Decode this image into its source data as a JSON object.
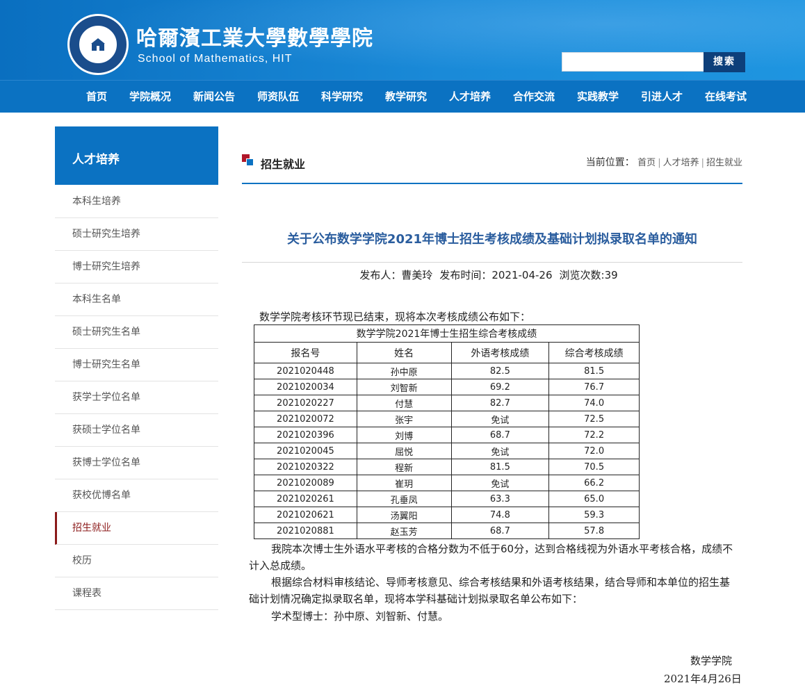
{
  "header": {
    "brand_cn": "哈爾濱工業大學數學學院",
    "brand_en": "School of Mathematics, HIT",
    "search": {
      "placeholder": "",
      "button": "搜索"
    }
  },
  "nav": [
    "首页",
    "学院概况",
    "新闻公告",
    "师资队伍",
    "科学研究",
    "教学研究",
    "人才培养",
    "合作交流",
    "实践教学",
    "引进人才",
    "在线考试"
  ],
  "sidebar": {
    "title": "人才培养",
    "items": [
      "本科生培养",
      "硕士研究生培养",
      "博士研究生培养",
      "本科生名单",
      "硕士研究生名单",
      "博士研究生名单",
      "获学士学位名单",
      "获硕士学位名单",
      "获博士学位名单",
      "获校优博名单",
      "招生就业",
      "校历",
      "课程表"
    ],
    "active": "招生就业"
  },
  "section": {
    "title": "招生就业",
    "breadcrumb_label": "当前位置：",
    "breadcrumb": [
      "首页",
      "人才培养",
      "招生就业"
    ]
  },
  "article": {
    "title": "关于公布数学学院2021年博士招生考核成绩及基础计划拟录取名单的通知",
    "author": "发布人：曹美玲",
    "date": "发布时间：2021-04-26",
    "views": "浏览次数:39",
    "intro": "数学学院考核环节现已结束，现将本次考核成绩公布如下：",
    "table": {
      "caption": "数学学院2021年博士生招生综合考核成绩",
      "headers": [
        "报名号",
        "姓名",
        "外语考核成绩",
        "综合考核成绩"
      ],
      "rows": [
        [
          "2021020448",
          "孙中原",
          "82.5",
          "81.5"
        ],
        [
          "2021020034",
          "刘智新",
          "69.2",
          "76.7"
        ],
        [
          "2021020227",
          "付慧",
          "82.7",
          "74.0"
        ],
        [
          "2021020072",
          "张宇",
          "免试",
          "72.5"
        ],
        [
          "2021020396",
          "刘博",
          "68.7",
          "72.2"
        ],
        [
          "2021020045",
          "屈悦",
          "免试",
          "72.0"
        ],
        [
          "2021020322",
          "程新",
          "81.5",
          "70.5"
        ],
        [
          "2021020089",
          "崔玥",
          "免试",
          "66.2"
        ],
        [
          "2021020261",
          "孔垂凤",
          "63.3",
          "65.0"
        ],
        [
          "2021020621",
          "汤翼阳",
          "74.8",
          "59.3"
        ],
        [
          "2021020881",
          "赵玉芳",
          "68.7",
          "57.8"
        ]
      ]
    },
    "note": "我院本次博士生外语水平考核的合格分数为不低于60分，达到合格线视为外语水平考核合格，成绩不计入总成绩。",
    "note2": "根据综合材料审核结论、导师考核意见、综合考核结果和外语考核结果，结合导师和本单位的招生基础计划情况确定拟录取名单，现将本学科基础计划拟录取名单公布如下：",
    "admitted": "学术型博士：孙中原、刘智新、付慧。",
    "signature_org": "数学学院",
    "signature_date": "2021年4月26日"
  },
  "colors": {
    "primary_blue": "#0b72c2",
    "active_red": "#8b1a1a",
    "title_blue": "#2a5d9e"
  }
}
